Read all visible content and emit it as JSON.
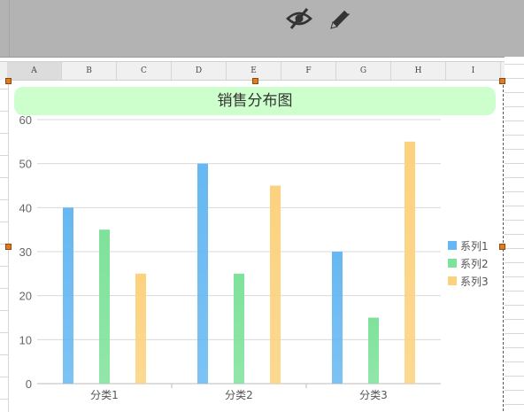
{
  "toolbar": {
    "icons": [
      "hide-eye-icon",
      "pencil-icon"
    ]
  },
  "sheet": {
    "columns": [
      "A",
      "B",
      "C",
      "D",
      "E",
      "F",
      "G",
      "H",
      "I"
    ],
    "active_column": "A"
  },
  "colors": {
    "series1": "#66b8f2",
    "series2": "#7ee29a",
    "series3": "#fcd27e",
    "title_bg": "#ccffcc",
    "toolbar_bg": "#b3b3b3"
  },
  "chart_data": {
    "type": "bar",
    "title": "销售分布图",
    "categories": [
      "分类1",
      "分类2",
      "分类3"
    ],
    "series": [
      {
        "name": "系列1",
        "values": [
          40,
          50,
          30
        ]
      },
      {
        "name": "系列2",
        "values": [
          35,
          25,
          15
        ]
      },
      {
        "name": "系列3",
        "values": [
          25,
          45,
          55
        ]
      }
    ],
    "ylim": [
      0,
      60
    ],
    "yticks": [
      0,
      10,
      20,
      30,
      40,
      50,
      60
    ],
    "grid": true,
    "legend": "right"
  }
}
